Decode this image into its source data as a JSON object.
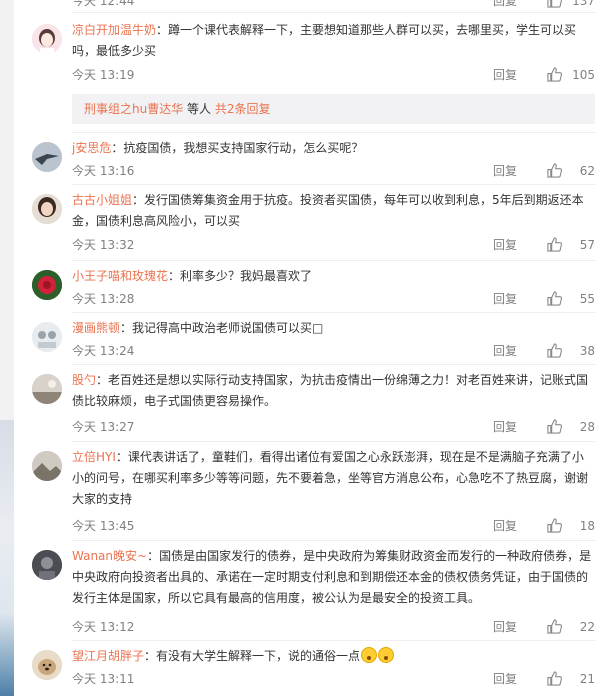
{
  "colors": {
    "username": "#eb7350",
    "meta": "#808080",
    "text": "#333333",
    "subreply_bg": "#f2f2f5"
  },
  "top_partial": {
    "time": "今天 12:44",
    "reply": "回复",
    "likes": "137"
  },
  "comments": [
    {
      "user": "凉白开加温牛奶",
      "text": "：蹲一个课代表解释一下，主要想知道那些人群可以买，去哪里买，学生可以买吗，最低多少买",
      "time": "今天 13:19",
      "reply": "回复",
      "likes": "105",
      "subreply": {
        "user": "刑事组之hu曹达华",
        "others": " 等人 ",
        "count": "共2条回复"
      }
    },
    {
      "user": "j安思危",
      "text": "：抗疫国债，我想买支持国家行动，怎么买呢？",
      "time": "今天 13:16",
      "reply": "回复",
      "likes": "62"
    },
    {
      "user": "古古小姐姐",
      "text": "：发行国债筹集资金用于抗疫。投资者买国债，每年可以收到利息，5年后到期返还本金，国债利息高风险小，可以买",
      "time": "今天 13:32",
      "reply": "回复",
      "likes": "57"
    },
    {
      "user": "小王子喵和玫瑰花",
      "text": "：利率多少？我妈最喜欢了",
      "time": "今天 13:28",
      "reply": "回复",
      "likes": "55"
    },
    {
      "user": "漫画熊顿",
      "text": "：我记得高中政治老师说国债可以买□",
      "time": "今天 13:24",
      "reply": "回复",
      "likes": "38"
    },
    {
      "user": "股勺",
      "text": "：老百姓还是想以实际行动支持国家，为抗击疫情出一份绵薄之力！对老百姓来讲，记账式国债比较麻烦，电子式国债更容易操作。",
      "time": "今天 13:27",
      "reply": "回复",
      "likes": "28"
    },
    {
      "user": "立倍HYI",
      "text": "：课代表讲话了，童鞋们，看得出诸位有爱国之心永跃澎湃，现在是不是满脑子充满了小小的问号，在哪买利率多少等等问题，先不要着急，坐等官方消息公布，心急吃不了热豆腐，谢谢大家的支持",
      "time": "今天 13:45",
      "reply": "回复",
      "likes": "18"
    },
    {
      "user": "Wanan晚安~",
      "text": "：国债是由国家发行的债券，是中央政府为筹集财政资金而发行的一种政府债券，是中央政府向投资者出具的、承诺在一定时期支付利息和到期偿还本金的债权债务凭证，由于国债的发行主体是国家，所以它具有最高的信用度，被公认为是最安全的投资工具。",
      "time": "今天 13:12",
      "reply": "回复",
      "likes": "22"
    },
    {
      "user": "望江月胡胖子",
      "text": "：有没有大学生解释一下，说的通俗一点",
      "time": "今天 13:11",
      "reply": "回复",
      "likes": "21"
    }
  ]
}
